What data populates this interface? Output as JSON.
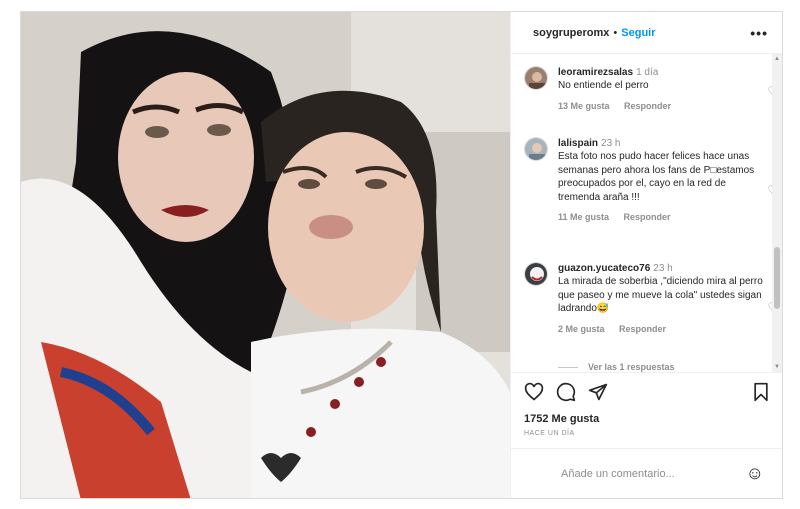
{
  "header": {
    "username": "soygruperomx",
    "separator": "•",
    "follow_label": "Seguir",
    "more_label": "•••"
  },
  "comments": [
    {
      "username": "leoramirezsalas",
      "time": "1 día",
      "text": "No entiende el perro",
      "likes": "13 Me gusta",
      "reply": "Responder"
    },
    {
      "username": "lalispain",
      "time": "23 h",
      "text": "Esta foto nos pudo hacer felices hace unas semanas pero ahora los fans de P□estamos preocupados por el, cayo en la red de tremenda araña !!!",
      "likes": "11 Me gusta",
      "reply": "Responder"
    },
    {
      "username": "guazon.yucateco76",
      "time": "23 h",
      "text": "La mirada de soberbia ,\"diciendo mira al perro que paseo y me mueve la cola\" ustedes sigan ladrando😅",
      "likes": "2 Me gusta",
      "reply": "Responder"
    }
  ],
  "view_replies": "Ver las 1 respuestas",
  "icons": {
    "heart": "heart-icon",
    "comment": "comment-icon",
    "share": "share-icon",
    "save": "bookmark-icon",
    "emoji": "emoji-icon"
  },
  "post": {
    "likes": "1752 Me gusta",
    "ago": "HACE UN DÍA"
  },
  "add_comment": {
    "placeholder": "Añade un comentario..."
  },
  "colors": {
    "accent": "#0095f6",
    "secondary_text": "#8e8e8e"
  }
}
